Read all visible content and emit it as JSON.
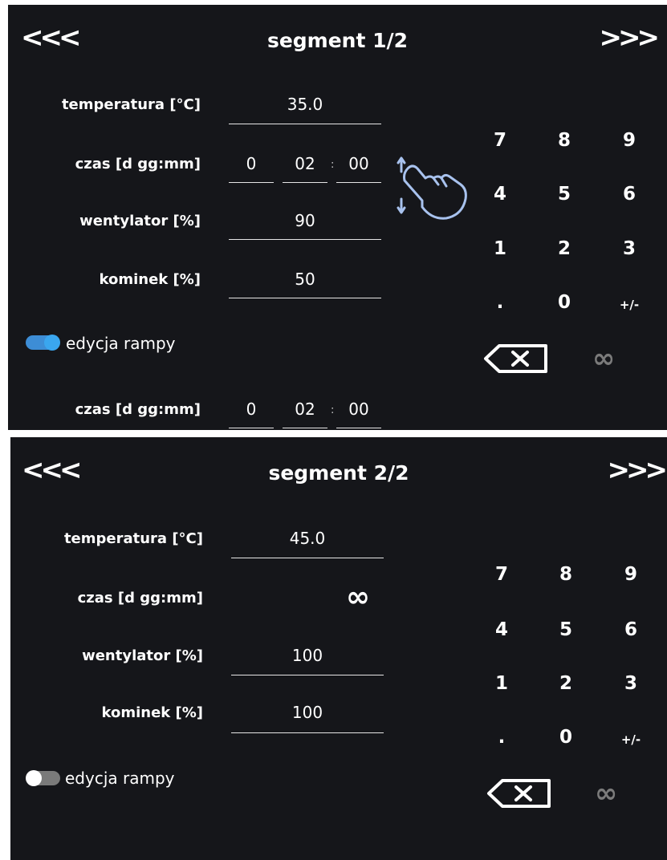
{
  "nav": {
    "prev": "<<<",
    "next": ">>>"
  },
  "segment1": {
    "title": "segment 1/2",
    "temperature": {
      "label": "temperatura [°C]",
      "value": "35.0"
    },
    "time": {
      "label": "czas [d gg:mm]",
      "days": "0",
      "hours": "02",
      "minutes": "00",
      "separator": ":"
    },
    "fan": {
      "label": "wentylator [%]",
      "value": "90"
    },
    "chimney": {
      "label": "kominek [%]",
      "value": "50"
    },
    "ramp": {
      "label": "edycja rampy",
      "enabled": true,
      "accent": "#3aa6ef"
    },
    "ramp_time": {
      "label": "czas [d gg:mm]",
      "days": "0",
      "hours": "02",
      "minutes": "00",
      "separator": ":"
    },
    "gesture_icon": "swipe-hand-icon"
  },
  "segment2": {
    "title": "segment 2/2",
    "temperature": {
      "label": "temperatura [°C]",
      "value": "45.0"
    },
    "time": {
      "label": "czas [d gg:mm]",
      "value": "∞"
    },
    "fan": {
      "label": "wentylator [%]",
      "value": "100"
    },
    "chimney": {
      "label": "kominek [%]",
      "value": "100"
    },
    "ramp": {
      "label": "edycja rampy",
      "enabled": false
    }
  },
  "keypad": {
    "keys": [
      "7",
      "8",
      "9",
      "4",
      "5",
      "6",
      "1",
      "2",
      "3",
      ".",
      "0",
      "+/-"
    ],
    "backspace_icon": "backspace-icon",
    "infinity": "∞",
    "infinity_color": "#7b7b7b"
  },
  "colors": {
    "background": "#15161a",
    "text": "#ffffff",
    "underline": "#e6e6e6"
  }
}
